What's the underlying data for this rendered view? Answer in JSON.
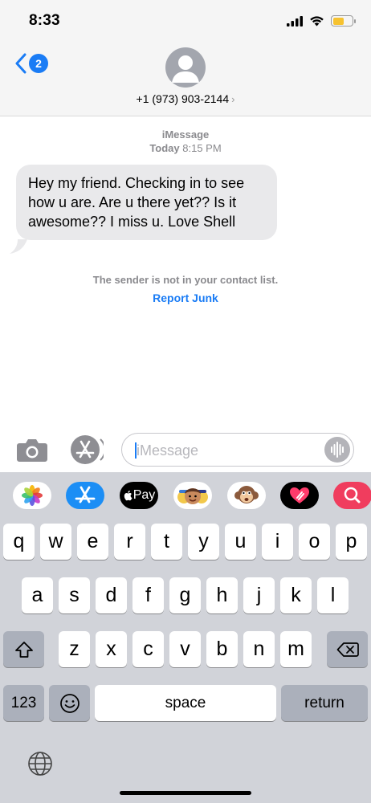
{
  "status_bar": {
    "time": "8:33"
  },
  "header": {
    "back_badge": "2",
    "contact": "+1 (973) 903-2144",
    "contact_chevron": "›"
  },
  "conversation": {
    "service": "iMessage",
    "date_day": "Today",
    "date_time": "8:15 PM",
    "messages": [
      {
        "direction": "incoming",
        "text": "Hey my friend. Checking in to see how u are. Are u there yet?? Is it awesome?? I miss u. Love Shell"
      }
    ],
    "notice": "The sender is not in your contact list.",
    "report_link": "Report Junk"
  },
  "composer": {
    "placeholder": "iMessage"
  },
  "app_strip": {
    "apps": [
      "photos-app-icon",
      "app-store-icon",
      "apple-pay-icon",
      "memoji-stickers-icon",
      "animoji-icon",
      "digital-touch-icon",
      "search-images-icon"
    ],
    "apple_pay_label": "Pay"
  },
  "keyboard": {
    "row1": [
      "q",
      "w",
      "e",
      "r",
      "t",
      "y",
      "u",
      "i",
      "o",
      "p"
    ],
    "row2": [
      "a",
      "s",
      "d",
      "f",
      "g",
      "h",
      "j",
      "k",
      "l"
    ],
    "row3": [
      "z",
      "x",
      "c",
      "v",
      "b",
      "n",
      "m"
    ],
    "numbers_key": "123",
    "space_key": "space",
    "return_key": "return"
  },
  "colors": {
    "accent": "#1a7cf5",
    "incoming_bubble": "#e9e9eb",
    "keyboard_bg": "#d1d3d9",
    "battery": "#f6c230"
  }
}
